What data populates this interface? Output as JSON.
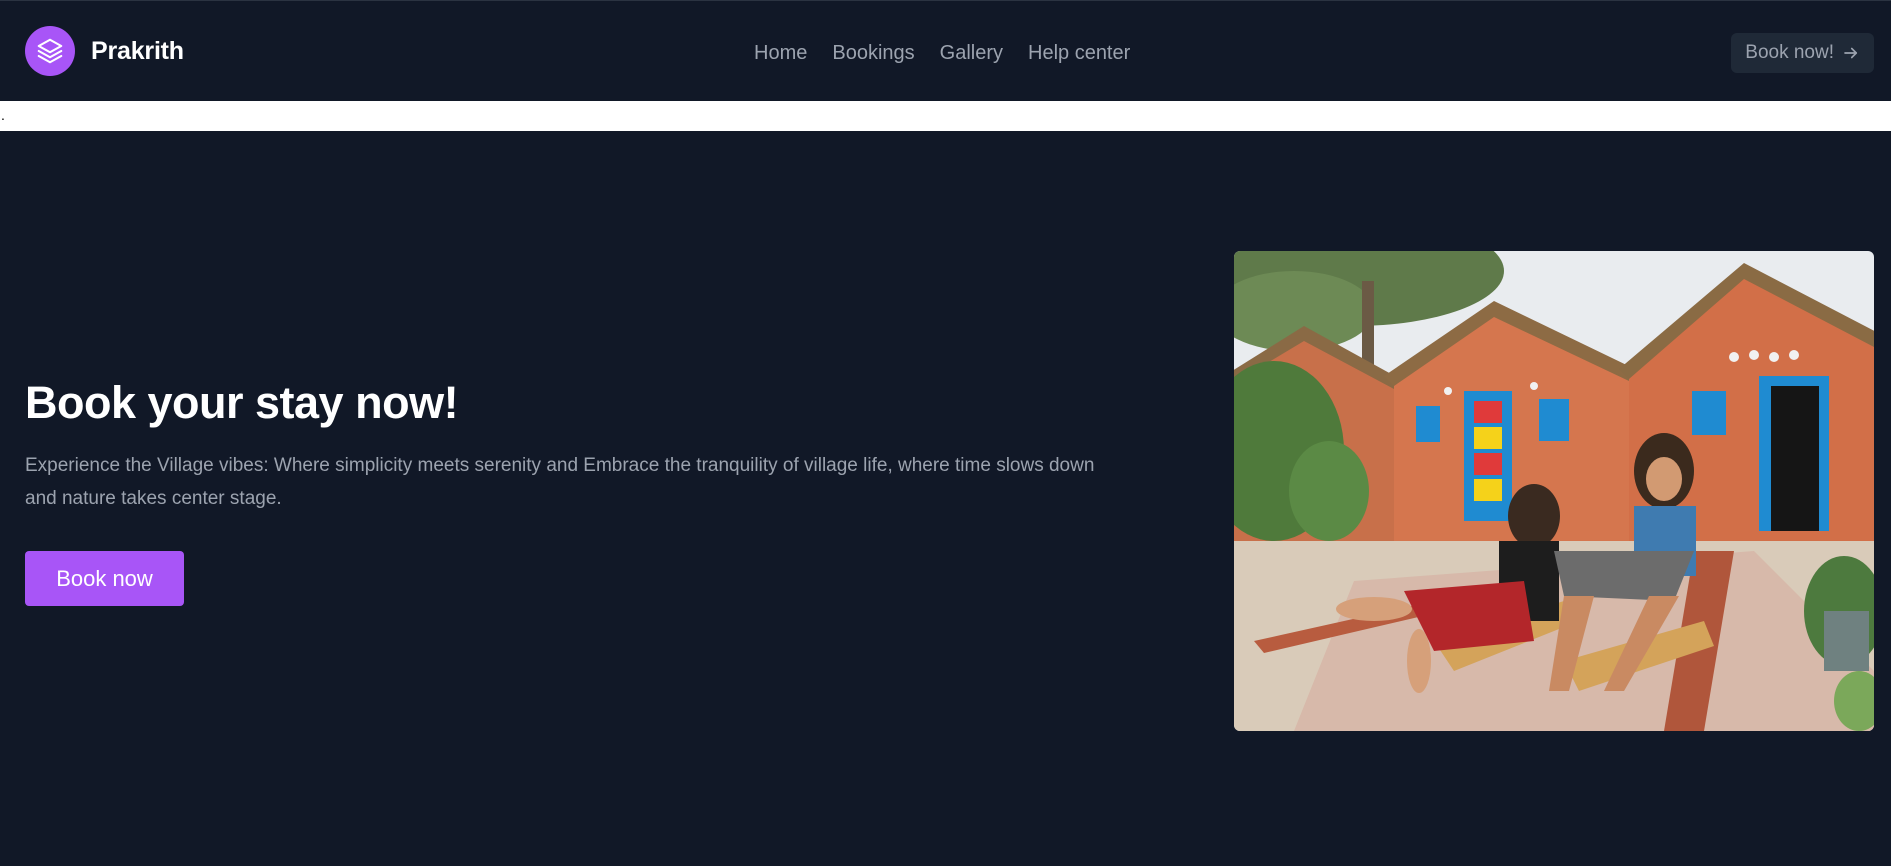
{
  "header": {
    "brand": "Prakrith",
    "logo_icon": "layers-icon",
    "nav": [
      {
        "label": "Home"
      },
      {
        "label": "Bookings"
      },
      {
        "label": "Gallery"
      },
      {
        "label": "Help center"
      }
    ],
    "cta_label": "Book now!",
    "cta_icon": "arrow-right-icon"
  },
  "strip": {
    "text": "."
  },
  "hero": {
    "title": "Book your stay now!",
    "description": "Experience the Village vibes: Where simplicity meets serenity and Embrace the tranquility of village life, where time slows down and nature takes center stage.",
    "button_label": "Book now"
  },
  "colors": {
    "background": "#111827",
    "accent": "#a855f7",
    "text_muted": "#9ca3af",
    "cta_bg": "#1f2937"
  }
}
